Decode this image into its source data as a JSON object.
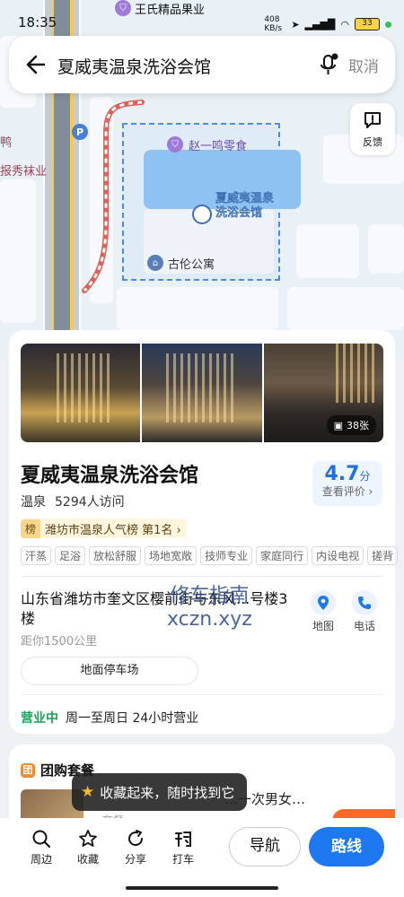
{
  "status": {
    "time": "18:35",
    "net_speed": "408 KB/s",
    "battery": "33"
  },
  "search": {
    "title": "夏威夷温泉洗浴会馆",
    "cancel": "取消"
  },
  "map": {
    "labels": {
      "top_shop": "王氏精品果业",
      "left_edge": "鸭",
      "left_street": "报秀袜业",
      "zhao_shop": "赵一鸣零食",
      "poi_line1": "夏威夷温泉",
      "poi_line2": "洗浴会馆",
      "gulun": "古伦公寓"
    },
    "feedback": "反馈"
  },
  "poi": {
    "photo_count": "38张",
    "name": "夏威夷温泉洗浴会馆",
    "category": "温泉",
    "visits": "5294人访问",
    "rating": "4.7",
    "rating_unit": "分",
    "rating_link": "查看评价 ›",
    "rank_tag": "榜",
    "rank_text": "潍坊市温泉人气榜 第1名 ›",
    "tags": [
      "汗蒸",
      "足浴",
      "放松舒服",
      "场地宽敞",
      "技师专业",
      "家庭同行",
      "内设电视",
      "搓背"
    ],
    "address": "山东省潍坊市奎文区樱前街与东风...号楼3楼",
    "distance": "距你1500公里",
    "map_action": "地图",
    "phone_action": "电话",
    "parking": "地面停车场",
    "open_status": "营业中",
    "hours": "周一至周日 24小时营业"
  },
  "watermark": {
    "line1": "修车指南",
    "line2": "xczn.xyz"
  },
  "group": {
    "title": "团购套餐",
    "deal": "…一次男女…",
    "deal_sub": "…套餐…"
  },
  "toast": "收藏起来，随时找到它",
  "bottom": {
    "nearby": "周边",
    "favorite": "收藏",
    "share": "分享",
    "taxi": "打车",
    "navigate": "导航",
    "route": "路线"
  },
  "colors": {
    "accent": "#1e78f0",
    "open": "#1aa35a",
    "rating": "#1e6fe8"
  }
}
